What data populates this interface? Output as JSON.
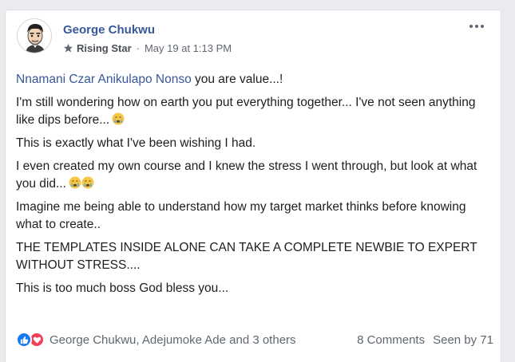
{
  "post": {
    "author": "George Chukwu",
    "badge_icon": "rising-star-badge-icon",
    "badge": "Rising Star",
    "separator": "·",
    "timestamp": "May 19 at 1:13 PM",
    "mention": "Nnamani Czar Anikulapo Nonso",
    "line1_rest": " you are value...!",
    "line2": "I'm still wondering how on earth you put everything together... I've not seen anything like dips before...",
    "line3": "This is exactly what I've been wishing I had.",
    "line4": "I even created my own course and I knew the stress I went through, but look at what you did...",
    "line5": "Imagine me being able to understand how my target market thinks before knowing what to create..",
    "line6": "THE TEMPLATES INSIDE ALONE CAN TAKE A COMPLETE NEWBIE TO EXPERT WITHOUT STRESS....",
    "line7": "This is too much boss God bless you..."
  },
  "footer": {
    "reaction_icons": [
      "like-icon",
      "love-icon"
    ],
    "reactors": "George Chukwu, Adejumoke Ade and 3 others",
    "comments": "8 Comments",
    "seen": "Seen by 71"
  },
  "colors": {
    "link": "#385898",
    "text": "#1c1e21",
    "meta": "#606770",
    "like": "#1877f2",
    "love": "#f33e58"
  }
}
